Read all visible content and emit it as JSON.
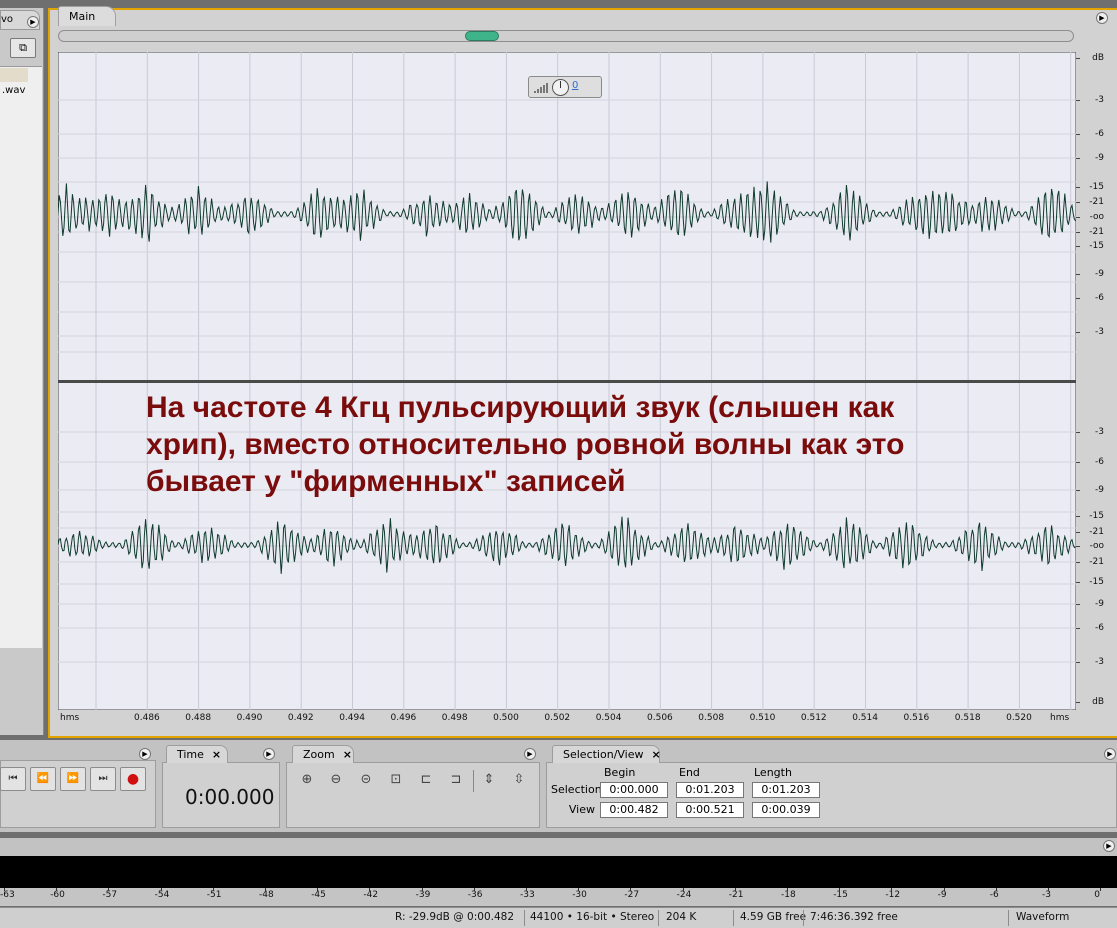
{
  "left_panel": {
    "tab_label": "vo",
    "file_item": ".wav"
  },
  "main_panel": {
    "tab_label": "Main",
    "volume_control_value": "0",
    "caption": [
      "На частоте 4 Кгц пульсирующий звук (слышен как",
      "хрип), вместо относительно ровной волны как это",
      "бывает у \"фирменных\" записей"
    ],
    "db_scale": [
      "dB",
      "-3",
      "-6",
      "-9",
      "-15",
      "-21",
      "-oo",
      "-21",
      "-15",
      "-9",
      "-6",
      "-3",
      "-3",
      "-6",
      "-9",
      "-15",
      "-21",
      "-oo",
      "-21",
      "-15",
      "-9",
      "-6",
      "-3",
      "dB"
    ],
    "time_ruler": {
      "start_unit": "hms",
      "end_unit": "hms",
      "ticks": [
        "0.486",
        "0.488",
        "0.490",
        "0.492",
        "0.494",
        "0.496",
        "0.498",
        "0.500",
        "0.502",
        "0.504",
        "0.506",
        "0.508",
        "0.510",
        "0.512",
        "0.514",
        "0.516",
        "0.518",
        "0.520"
      ]
    }
  },
  "transport_panel": {
    "buttons": [
      "go-to-start",
      "rewind",
      "fast-forward",
      "go-to-end",
      "record"
    ]
  },
  "time_panel": {
    "tab_label": "Time",
    "close": "×",
    "display": "0:00.000"
  },
  "zoom_panel": {
    "tab_label": "Zoom",
    "close": "×"
  },
  "selection_panel": {
    "tab_label": "Selection/View",
    "close": "×",
    "headers": {
      "begin": "Begin",
      "end": "End",
      "length": "Length"
    },
    "rows": {
      "selection": {
        "label": "Selection",
        "begin": "0:00.000",
        "end": "0:01.203",
        "length": "0:01.203"
      },
      "view": {
        "label": "View",
        "begin": "0:00.482",
        "end": "0:00.521",
        "length": "0:00.039"
      }
    }
  },
  "level_meter": {
    "scale": [
      "-63",
      "-60",
      "-57",
      "-54",
      "-51",
      "-48",
      "-45",
      "-42",
      "-39",
      "-36",
      "-33",
      "-30",
      "-27",
      "-24",
      "-21",
      "-18",
      "-15",
      "-12",
      "-9",
      "-6",
      "-3",
      "0"
    ]
  },
  "status_bar": {
    "cursor_info": "R: -29.9dB @   0:00.482",
    "format": "44100 • 16-bit • Stereo",
    "size": "204 K",
    "disk_free": "4.59 GB free",
    "time_free": "7:46:36.392 free",
    "view_mode": "Waveform"
  },
  "colors": {
    "waveform_bg": "#ebebf3",
    "waveform_line": "#0e3a2c",
    "accent_border": "#e3a400",
    "caption_text": "#7a0c0c",
    "scroll_thumb": "#3fb48a"
  }
}
